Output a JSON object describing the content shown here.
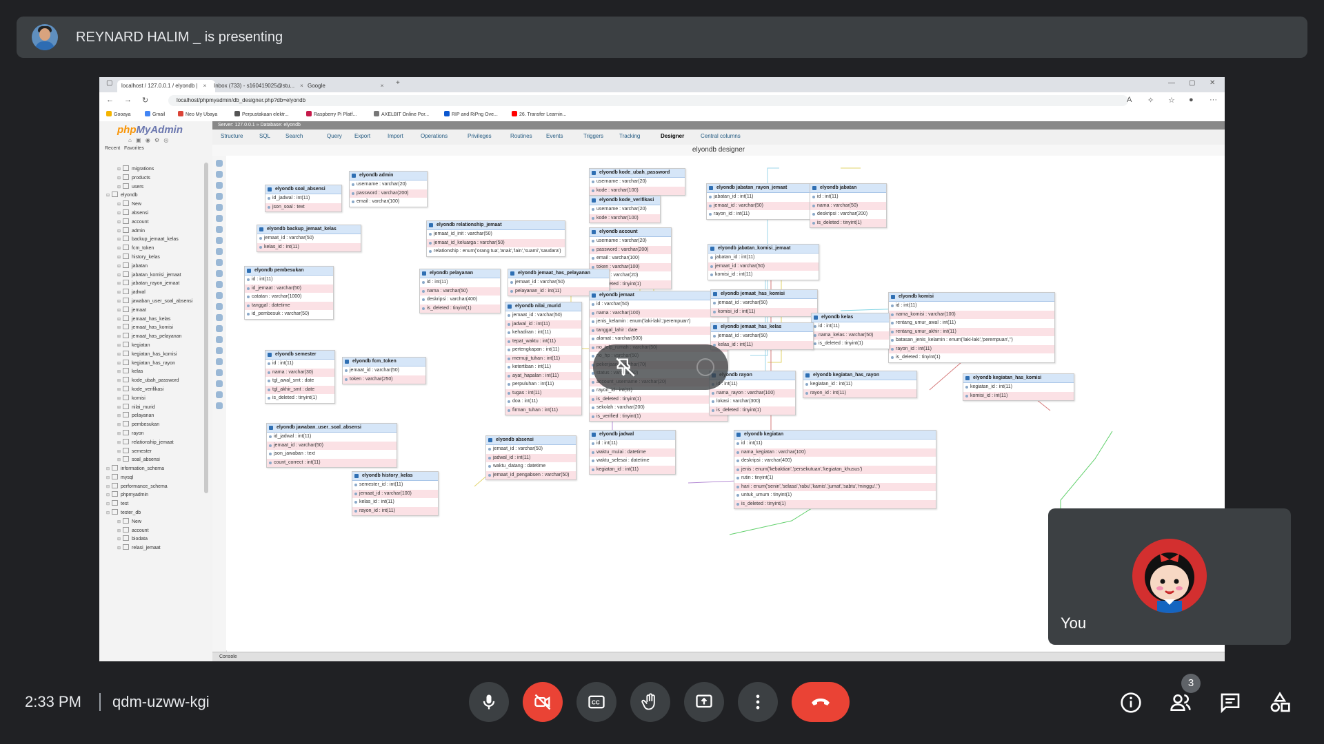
{
  "meeting": {
    "presenter_text": "REYNARD HALIM _ is presenting",
    "time": "2:33 PM",
    "meeting_code": "qdm-uzww-kgi",
    "self_label": "You",
    "participants_badge": "3"
  },
  "controls": {
    "mic": "microphone-icon",
    "camera": "camera-off-icon",
    "captions": "captions-icon",
    "raise_hand": "raise-hand-icon",
    "present": "present-screen-icon",
    "more": "more-options-icon",
    "hangup": "hang-up-icon",
    "info": "info-icon",
    "people": "people-icon",
    "chat": "chat-icon",
    "activities": "activities-icon",
    "hangup_color": "#ea4335"
  },
  "browser": {
    "tabs": [
      "localhost / 127.0.0.1 / elyondb |",
      "Inbox (733) - s160419025@stu...",
      "Google"
    ],
    "url": "localhost/phpmyadmin/db_designer.php?db=elyondb",
    "bookmarks": [
      "Gooaya",
      "Gmail",
      "Neo My Ubaya",
      "Perpustakaan elektr...",
      "Raspberry Pi Platf...",
      "AXELBIT Online Por...",
      "RIP and RiPng Ove...",
      "26. Transfer Learnin..."
    ]
  },
  "pma": {
    "logo_php": "php",
    "logo_myadmin": "MyAdmin",
    "recent": "Recent",
    "favorites": "Favorites",
    "server_bar": "Server: 127.0.0.1 » Database: elyondb",
    "tabs": [
      "Structure",
      "SQL",
      "Search",
      "Query",
      "Export",
      "Import",
      "Operations",
      "Privileges",
      "Routines",
      "Events",
      "Triggers",
      "Tracking",
      "Designer",
      "Central columns"
    ],
    "designer_title": "elyondb designer",
    "console": "Console",
    "tree": [
      "migrations",
      "products",
      "users",
      "elyondb",
      "New",
      "absensi",
      "account",
      "admin",
      "backup_jemaat_kelas",
      "fcm_token",
      "history_kelas",
      "jabatan",
      "jabatan_komisi_jemaat",
      "jabatan_rayon_jemaat",
      "jadwal",
      "jawaban_user_soal_absensi",
      "jemaat",
      "jemaat_has_kelas",
      "jemaat_has_komisi",
      "jemaat_has_pelayanan",
      "kegiatan",
      "kegiatan_has_komisi",
      "kegiatan_has_rayon",
      "kelas",
      "kode_ubah_password",
      "kode_verifikasi",
      "komisi",
      "nilai_murid",
      "pelayanan",
      "pembesukan",
      "rayon",
      "relationship_jemaat",
      "semester",
      "soal_absensi",
      "information_schema",
      "mysql",
      "performance_schema",
      "phpmyadmin",
      "test",
      "tester_db",
      "New",
      "account",
      "biodata",
      "relasi_jemaat"
    ]
  },
  "er_tables": [
    {
      "name": "elyondb soal_absensi",
      "rows": [
        "id_jadwal : int(11)",
        "json_soal : text"
      ]
    },
    {
      "name": "elyondb admin",
      "rows": [
        "username : varchar(20)",
        "password : varchar(200)",
        "email : varchar(100)"
      ]
    },
    {
      "name": "elyondb backup_jemaat_kelas",
      "rows": [
        "jemaat_id : varchar(50)",
        "kelas_id : int(11)"
      ]
    },
    {
      "name": "elyondb relationship_jemaat",
      "rows": [
        "jemaat_id_init : varchar(50)",
        "jemaat_id_keluarga : varchar(50)",
        "relationship : enum('orang tua','anak','lain','suami','saudara')"
      ]
    },
    {
      "name": "elyondb kode_ubah_password",
      "rows": [
        "username : varchar(20)",
        "kode : varchar(100)"
      ]
    },
    {
      "name": "elyondb kode_verifikasi",
      "rows": [
        "username : varchar(20)",
        "kode : varchar(100)"
      ]
    },
    {
      "name": "elyondb account",
      "rows": [
        "username : varchar(20)",
        "password : varchar(200)",
        "email : varchar(100)",
        "token : varchar(100)",
        "status : varchar(20)",
        "is_deleted : tinyint(1)"
      ]
    },
    {
      "name": "elyondb jabatan_rayon_jemaat",
      "rows": [
        "jabatan_id : int(11)",
        "jemaat_id : varchar(50)",
        "rayon_id : int(11)"
      ]
    },
    {
      "name": "elyondb jabatan",
      "rows": [
        "id : int(11)",
        "nama : varchar(50)",
        "deskripsi : varchar(200)",
        "is_deleted : tinyint(1)"
      ]
    },
    {
      "name": "elyondb jabatan_komisi_jemaat",
      "rows": [
        "jabatan_id : int(11)",
        "jemaat_id : varchar(50)",
        "komisi_id : int(11)"
      ]
    },
    {
      "name": "elyondb pembesukan",
      "rows": [
        "id : int(11)",
        "id_jemaat : varchar(50)",
        "catatan : varchar(1000)",
        "tanggal : datetime",
        "id_pembesuk : varchar(50)"
      ]
    },
    {
      "name": "elyondb pelayanan",
      "rows": [
        "id : int(11)",
        "nama : varchar(50)",
        "deskripsi : varchar(400)",
        "is_deleted : tinyint(1)"
      ]
    },
    {
      "name": "elyondb jemaat_has_pelayanan",
      "rows": [
        "jemaat_id : varchar(50)",
        "pelayanan_id : int(11)"
      ]
    },
    {
      "name": "elyondb nilai_murid",
      "rows": [
        "jemaat_id : varchar(50)",
        "jadwal_id : int(11)",
        "kehadiran : int(11)",
        "tepat_waktu : int(11)",
        "pertengkapan : int(11)",
        "memuji_tuhan : int(11)",
        "ketertiban : int(11)",
        "ayat_hapalan : int(11)",
        "perpuluhan : int(11)",
        "tugas : int(11)",
        "doa : int(11)",
        "firman_tuhan : int(11)"
      ]
    },
    {
      "name": "elyondb jemaat",
      "rows": [
        "id : varchar(50)",
        "nama : varchar(100)",
        "jenis_kelamin : enum('laki-laki','perempuan')",
        "tanggal_lahir : date",
        "alamat : varchar(500)",
        "no_telp_rumah : varchar(50)",
        "no_hp : varchar(50)",
        "pekerjaan : varchar(70)",
        "status : varchar(50)",
        "account_username : varchar(20)",
        "rayon_id : int(11)",
        "is_deleted : tinyint(1)",
        "sekolah : varchar(200)",
        "is_verified : tinyint(1)"
      ]
    },
    {
      "name": "elyondb jemaat_has_komisi",
      "rows": [
        "jemaat_id : varchar(50)",
        "komisi_id : int(11)"
      ]
    },
    {
      "name": "elyondb komisi",
      "rows": [
        "id : int(11)",
        "nama_komisi : varchar(100)",
        "rentang_umur_awal : int(11)",
        "rentang_umur_akhir : int(11)",
        "batasan_jenis_kelamin : enum('laki-laki','perempuan','')",
        "rayon_id : int(11)",
        "is_deleted : tinyint(1)"
      ]
    },
    {
      "name": "elyondb kelas",
      "rows": [
        "id : int(11)",
        "nama_kelas : varchar(50)",
        "is_deleted : tinyint(1)"
      ]
    },
    {
      "name": "elyondb jemaat_has_kelas",
      "rows": [
        "jemaat_id : varchar(50)",
        "kelas_id : int(11)"
      ]
    },
    {
      "name": "elyondb semester",
      "rows": [
        "id : int(11)",
        "nama : varchar(30)",
        "tgl_awal_smt : date",
        "tgl_akhir_smt : date",
        "is_deleted : tinyint(1)"
      ]
    },
    {
      "name": "elyondb fcm_token",
      "rows": [
        "jemaat_id : varchar(50)",
        "token : varchar(250)"
      ]
    },
    {
      "name": "elyondb rayon",
      "rows": [
        "id : int(11)",
        "nama_rayon : varchar(100)",
        "lokasi : varchar(300)",
        "is_deleted : tinyint(1)"
      ]
    },
    {
      "name": "elyondb kegiatan_has_rayon",
      "rows": [
        "kegiatan_id : int(11)",
        "rayon_id : int(11)"
      ]
    },
    {
      "name": "elyondb kegiatan_has_komisi",
      "rows": [
        "kegiatan_id : int(11)",
        "komisi_id : int(11)"
      ]
    },
    {
      "name": "elyondb jawaban_user_soal_absensi",
      "rows": [
        "id_jadwal : int(11)",
        "jemaat_id : varchar(50)",
        "json_jawaban : text",
        "count_correct : int(11)"
      ]
    },
    {
      "name": "elyondb absensi",
      "rows": [
        "jemaat_id : varchar(50)",
        "jadwal_id : int(11)",
        "waktu_datang : datetime",
        "jemaat_id_pengabsen : varchar(50)"
      ]
    },
    {
      "name": "elyondb jadwal",
      "rows": [
        "id : int(11)",
        "waktu_mulai : datetime",
        "waktu_selesai : datetime",
        "kegiatan_id : int(11)"
      ]
    },
    {
      "name": "elyondb kegiatan",
      "rows": [
        "id : int(11)",
        "nama_kegiatan : varchar(100)",
        "deskripsi : varchar(400)",
        "jenis : enum('kebaktian','persekutuan','kegiatan_khusus')",
        "rutin : tinyint(1)",
        "hari : enum('senin','selasa','rabu','kamis','jumat','sabtu','minggu','')",
        "untuk_umum : tinyint(1)",
        "is_deleted : tinyint(1)"
      ]
    },
    {
      "name": "elyondb history_kelas",
      "rows": [
        "semester_id : int(11)",
        "jemaat_id : varchar(100)",
        "kelas_id : int(11)",
        "rayon_id : int(11)"
      ]
    }
  ]
}
